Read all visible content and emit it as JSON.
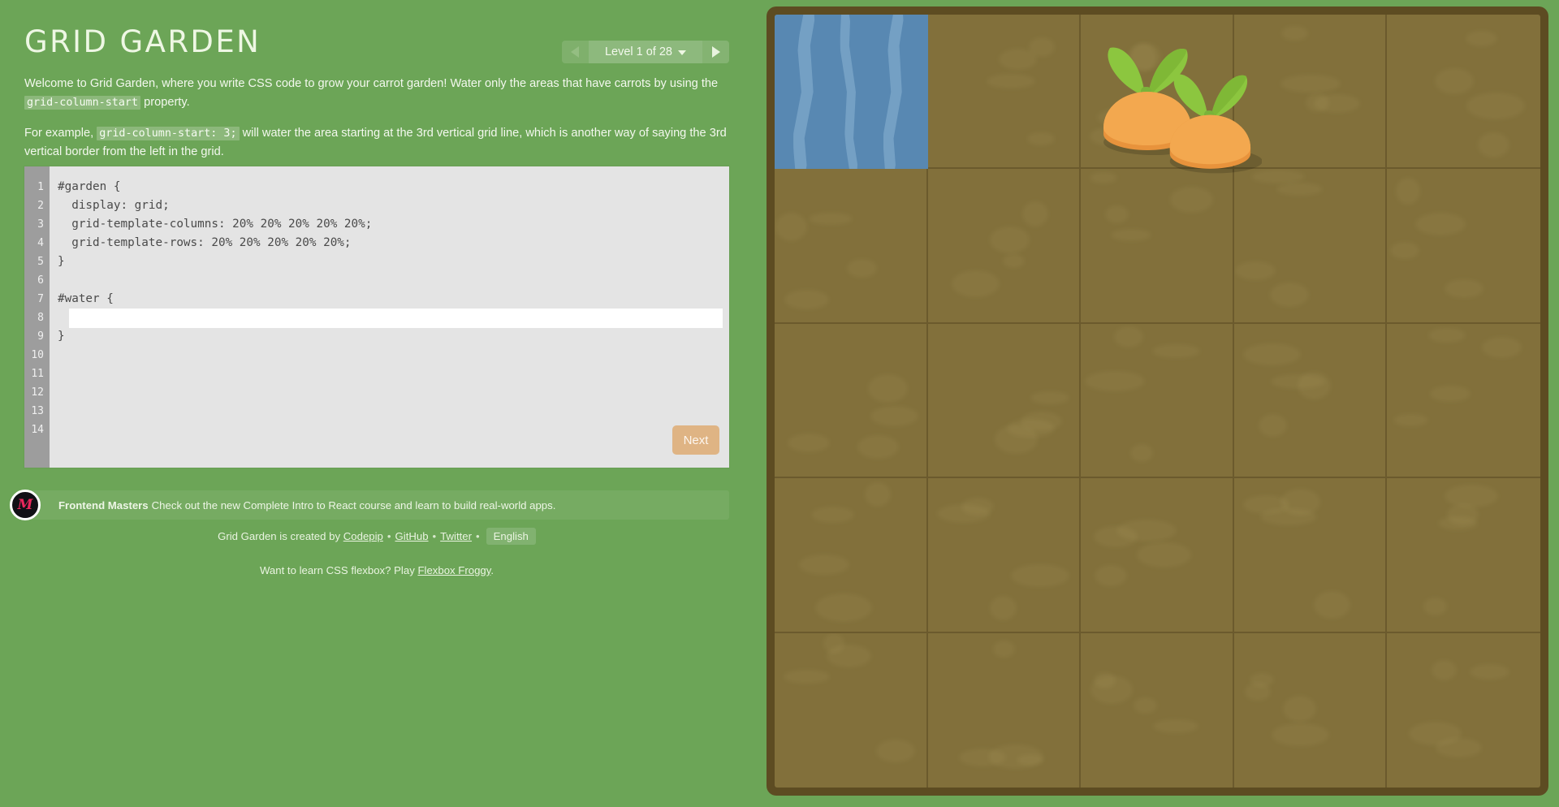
{
  "page": {
    "title": "GRID GARDEN",
    "background_color": "#6ca557",
    "title_color": "#eef7e4"
  },
  "level_selector": {
    "prev_label": "previous level",
    "next_label": "next level",
    "display": "Level 1 of 28",
    "current_level": 1,
    "total_levels": 28,
    "prev_disabled": true
  },
  "instructions": {
    "paragraph1_part1": "Welcome to Grid Garden, where you write CSS code to grow your carrot garden! Water only the areas that have carrots by using the ",
    "paragraph1_code": "grid-column-start",
    "paragraph1_part2": " property.",
    "paragraph2_part1": "For example, ",
    "paragraph2_code": "grid-column-start: 3;",
    "paragraph2_part2": " will water the area starting at the 3rd vertical grid line, which is another way of saying the 3rd vertical border from the left in the grid."
  },
  "editor": {
    "line_numbers": [
      "1",
      "2",
      "3",
      "4",
      "5",
      "6",
      "7",
      "8",
      "9",
      "10",
      "11",
      "12",
      "13",
      "14"
    ],
    "code_lines": [
      "#garden {",
      "  display: grid;",
      "  grid-template-columns: 20% 20% 20% 20% 20%;",
      "  grid-template-rows: 20% 20% 20% 20% 20%;",
      "}",
      "",
      "#water {",
      "",
      "}"
    ],
    "input_value": "",
    "input_placeholder": "",
    "next_label": "Next",
    "next_color": "#dfb484",
    "background_color": "#e4e4e4",
    "gutter_color": "#9d9d9d"
  },
  "sponsor": {
    "logo": "frontend-masters-logo",
    "logo_letter": "M",
    "brand": "Frontend Masters",
    "message": "Check out the new Complete Intro to React course and learn to build real-world apps."
  },
  "footer": {
    "credit_prefix": "Grid Garden is created by ",
    "links": [
      {
        "label": "Codepip"
      },
      {
        "label": "GitHub"
      },
      {
        "label": "Twitter"
      }
    ],
    "separator": "•",
    "language_label": "English",
    "flexbox_prefix": "Want to learn CSS flexbox? Play ",
    "flexbox_link": "Flexbox Froggy",
    "flexbox_suffix": "."
  },
  "garden": {
    "columns": 5,
    "rows": 5,
    "dirt_color": "#82703b",
    "grid_line_color": "#6b5a2d",
    "border_color": "#5d4c22",
    "water_color": "#5888b2",
    "water_wave_color": "#74a0c4",
    "carrot_body_color": "#f0a04b",
    "carrot_leaf_color": "#8cc63f",
    "water_cells": [
      {
        "row": 1,
        "column": 1
      }
    ],
    "carrots": [
      {
        "row": 1,
        "column": 3,
        "position": "left"
      },
      {
        "row": 1,
        "column": 3,
        "position": "right"
      }
    ]
  }
}
